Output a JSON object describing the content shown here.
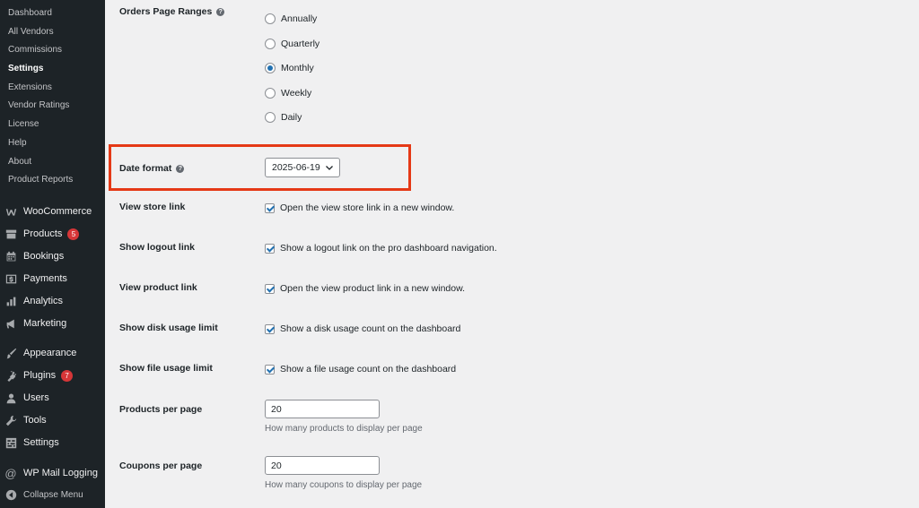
{
  "sidebar": {
    "submenu": [
      {
        "label": "Dashboard"
      },
      {
        "label": "All Vendors"
      },
      {
        "label": "Commissions"
      },
      {
        "label": "Settings"
      },
      {
        "label": "Extensions"
      },
      {
        "label": "Vendor Ratings"
      },
      {
        "label": "License"
      },
      {
        "label": "Help"
      },
      {
        "label": "About"
      },
      {
        "label": "Product Reports"
      }
    ],
    "menu": [
      {
        "label": "WooCommerce",
        "icon": "woocommerce-icon"
      },
      {
        "label": "Products",
        "icon": "products-icon",
        "badge": "5"
      },
      {
        "label": "Bookings",
        "icon": "calendar-icon"
      },
      {
        "label": "Payments",
        "icon": "payments-icon"
      },
      {
        "label": "Analytics",
        "icon": "analytics-icon"
      },
      {
        "label": "Marketing",
        "icon": "megaphone-icon"
      },
      {
        "label": "Appearance",
        "icon": "paintbrush-icon"
      },
      {
        "label": "Plugins",
        "icon": "plugin-icon",
        "badge": "7"
      },
      {
        "label": "Users",
        "icon": "user-icon"
      },
      {
        "label": "Tools",
        "icon": "wrench-icon"
      },
      {
        "label": "Settings",
        "icon": "settings-icon"
      },
      {
        "label": "WP Mail Logging",
        "icon": "at-icon"
      },
      {
        "label": "Collapse Menu",
        "icon": "collapse-icon"
      }
    ]
  },
  "settings": {
    "orders_ranges": {
      "label": "Orders Page Ranges",
      "options": [
        "Annually",
        "Quarterly",
        "Monthly",
        "Weekly",
        "Daily"
      ],
      "selected": "Monthly"
    },
    "date_format": {
      "label": "Date format",
      "value": "2025-06-19"
    },
    "view_store_link": {
      "label": "View store link",
      "text": "Open the view store link in a new window.",
      "checked": true
    },
    "show_logout_link": {
      "label": "Show logout link",
      "text": "Show a logout link on the pro dashboard navigation.",
      "checked": true
    },
    "view_product_link": {
      "label": "View product link",
      "text": "Open the view product link in a new window.",
      "checked": true
    },
    "show_disk_usage": {
      "label": "Show disk usage limit",
      "text": "Show a disk usage count on the dashboard",
      "checked": true
    },
    "show_file_usage": {
      "label": "Show file usage limit",
      "text": "Show a file usage count on the dashboard",
      "checked": true
    },
    "products_per_page": {
      "label": "Products per page",
      "value": "20",
      "description": "How many products to display per page"
    },
    "coupons_per_page": {
      "label": "Coupons per page",
      "value": "20",
      "description": "How many coupons to display per page"
    }
  },
  "colors": {
    "sidebar_bg": "#1d2327",
    "accent": "#2271b1",
    "highlight": "#e53916",
    "badge": "#d63638"
  }
}
